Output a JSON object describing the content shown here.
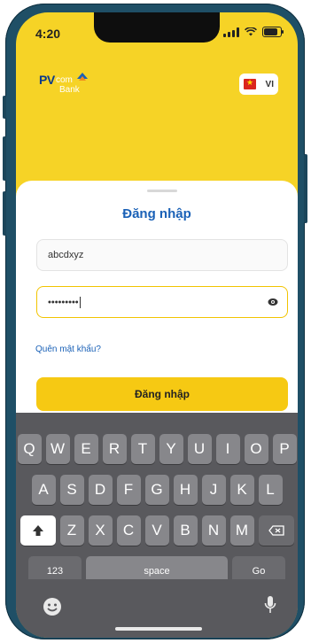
{
  "status_bar": {
    "time": "4:20"
  },
  "header": {
    "logo_pv": "PV",
    "logo_com": "com",
    "logo_bank": "Bank",
    "language_label": "VI"
  },
  "login": {
    "title": "Đăng nhập",
    "username_value": "abcdxyz",
    "password_mask": "•••••••••",
    "forgot_link": "Quên mật khẩu?",
    "login_button": "Đăng nhập"
  },
  "keyboard": {
    "row1": [
      "Q",
      "W",
      "E",
      "R",
      "T",
      "Y",
      "U",
      "I",
      "O",
      "P"
    ],
    "row2": [
      "A",
      "S",
      "D",
      "F",
      "G",
      "H",
      "J",
      "K",
      "L"
    ],
    "row3": [
      "Z",
      "X",
      "C",
      "V",
      "B",
      "N",
      "M"
    ],
    "numbers_key": "123",
    "space_key": "space",
    "go_key": "Go"
  },
  "colors": {
    "brand_yellow": "#f6d326",
    "button_yellow": "#f6c913",
    "link_blue": "#1a61b7",
    "frame": "#1f4f66"
  }
}
